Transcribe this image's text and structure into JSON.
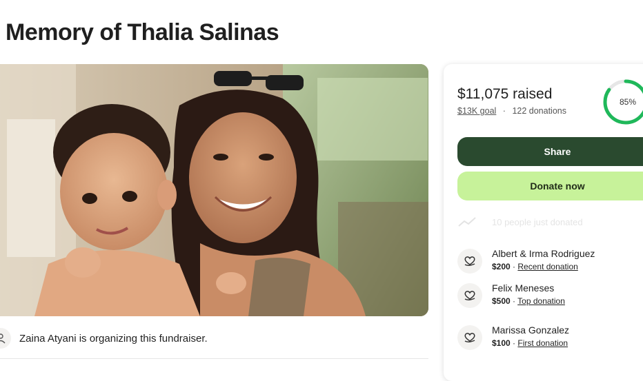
{
  "page": {
    "title": "Memory of Thalia Salinas"
  },
  "organizer": {
    "text": "Zaina Atyani is organizing this fundraiser."
  },
  "donation_card": {
    "raised": "$11,075 raised",
    "goal": "$13K goal",
    "separator": "·",
    "donation_count": "122 donations",
    "progress_label": "85%",
    "progress_fraction": 0.85,
    "share_label": "Share",
    "donate_label": "Donate now",
    "faded_text": "10 people just donated",
    "donors": [
      {
        "name": "Albert & Irma Rodriguez",
        "amount": "$200",
        "tag": "Recent donation"
      },
      {
        "name": "Felix Meneses",
        "amount": "$500",
        "tag": "Top donation"
      },
      {
        "name": "Marissa Gonzalez",
        "amount": "$100",
        "tag": "First donation"
      }
    ]
  },
  "colors": {
    "share_button": "#2a4a2f",
    "donate_button": "#c7f29a",
    "progress": "#1fb85a"
  }
}
